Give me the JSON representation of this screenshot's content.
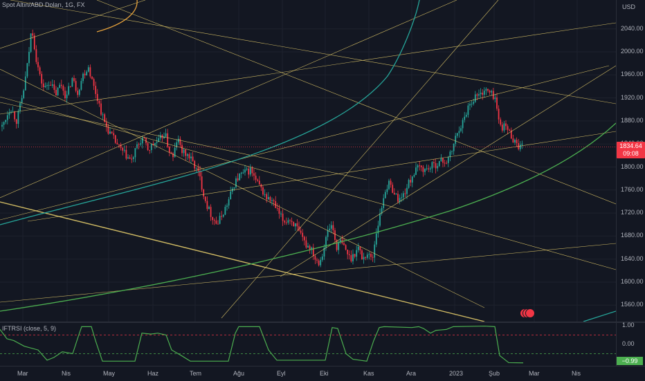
{
  "legend": {
    "symbol": "Spot Altın/ABD Doları, 1G, FX"
  },
  "price_axis": {
    "currency": "USD",
    "ticks": [
      "2040.00",
      "2000.00",
      "1960.00",
      "1920.00",
      "1880.00",
      "1840.00",
      "1800.00",
      "1760.00",
      "1720.00",
      "1680.00",
      "1640.00",
      "1600.00",
      "1560.00"
    ]
  },
  "last_price": {
    "value": "1834.64",
    "countdown": "09:08",
    "color": "#f23645"
  },
  "oscillator": {
    "name": "IFTRSI (close, 5, 9)",
    "ticks": [
      "1.00",
      "0.00",
      "-1.00"
    ],
    "last_value": "−0.99",
    "line_color": "#4caf50",
    "upper_color": "#f23645",
    "lower_color": "#4caf50"
  },
  "time_axis": {
    "ticks": [
      "Mar",
      "Nis",
      "May",
      "Haz",
      "Tem",
      "Ağu",
      "Eyl",
      "Eki",
      "Kas",
      "Ara",
      "2023",
      "Şub",
      "Mar",
      "Nis"
    ]
  },
  "colors": {
    "up": "#26a69a",
    "down": "#f23645",
    "trend": "#f0d66e",
    "teal_curve": "#26a69a",
    "green_curve": "#4caf50",
    "orange_curve": "#e8a33c"
  },
  "chart_data": {
    "type": "candlestick",
    "x_range": [
      "2022-02-24",
      "2023-04-20"
    ],
    "ylim": [
      1540,
      2070
    ],
    "ylabel": "USD",
    "key_points": [
      {
        "x": "2022-03-08",
        "high": 2070
      },
      {
        "x": "2022-09-28",
        "low": 1615
      },
      {
        "x": "2022-11-03",
        "low": 1618
      },
      {
        "x": "2023-02-02",
        "high": 1960
      },
      {
        "x": "2023-02-23",
        "close": 1834.64
      }
    ]
  }
}
